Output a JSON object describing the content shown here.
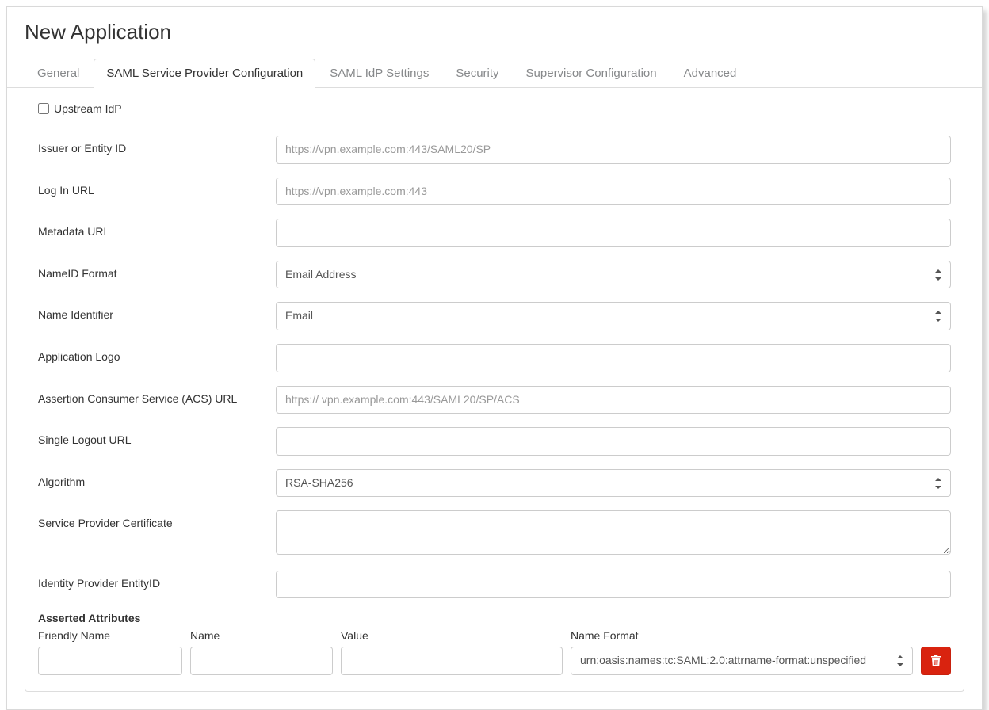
{
  "page_title": "New Application",
  "tabs": {
    "general": "General",
    "saml_sp_config": "SAML Service Provider Configuration",
    "saml_idp_settings": "SAML IdP Settings",
    "security": "Security",
    "supervisor_configuration": "Supervisor Configuration",
    "advanced": "Advanced"
  },
  "form": {
    "upstream_idp": {
      "label": "Upstream IdP",
      "checked": false
    },
    "issuer": {
      "label": "Issuer or Entity ID",
      "placeholder": "https://vpn.example.com:443/SAML20/SP",
      "value": ""
    },
    "login_url": {
      "label": "Log In URL",
      "placeholder": "https://vpn.example.com:443",
      "value": ""
    },
    "metadata_url": {
      "label": "Metadata URL",
      "value": ""
    },
    "nameid_format": {
      "label": "NameID Format",
      "selected": "Email Address"
    },
    "name_identifier": {
      "label": "Name Identifier",
      "selected": "Email"
    },
    "application_logo": {
      "label": "Application Logo",
      "value": ""
    },
    "acs_url": {
      "label": "Assertion Consumer Service (ACS) URL",
      "placeholder": "https:// vpn.example.com:443/SAML20/SP/ACS",
      "value": ""
    },
    "single_logout_url": {
      "label": "Single Logout URL",
      "value": ""
    },
    "algorithm": {
      "label": "Algorithm",
      "selected": "RSA-SHA256"
    },
    "sp_certificate": {
      "label": "Service Provider Certificate",
      "value": ""
    },
    "idp_entity_id": {
      "label": "Identity Provider EntityID",
      "value": ""
    }
  },
  "asserted_attributes": {
    "heading": "Asserted Attributes",
    "columns": {
      "friendly_name": "Friendly Name",
      "name": "Name",
      "value": "Value",
      "name_format": "Name Format"
    },
    "row": {
      "friendly_name": "",
      "name": "",
      "value": "",
      "name_format_selected": "urn:oasis:names:tc:SAML:2.0:attrname-format:unspecified"
    }
  }
}
